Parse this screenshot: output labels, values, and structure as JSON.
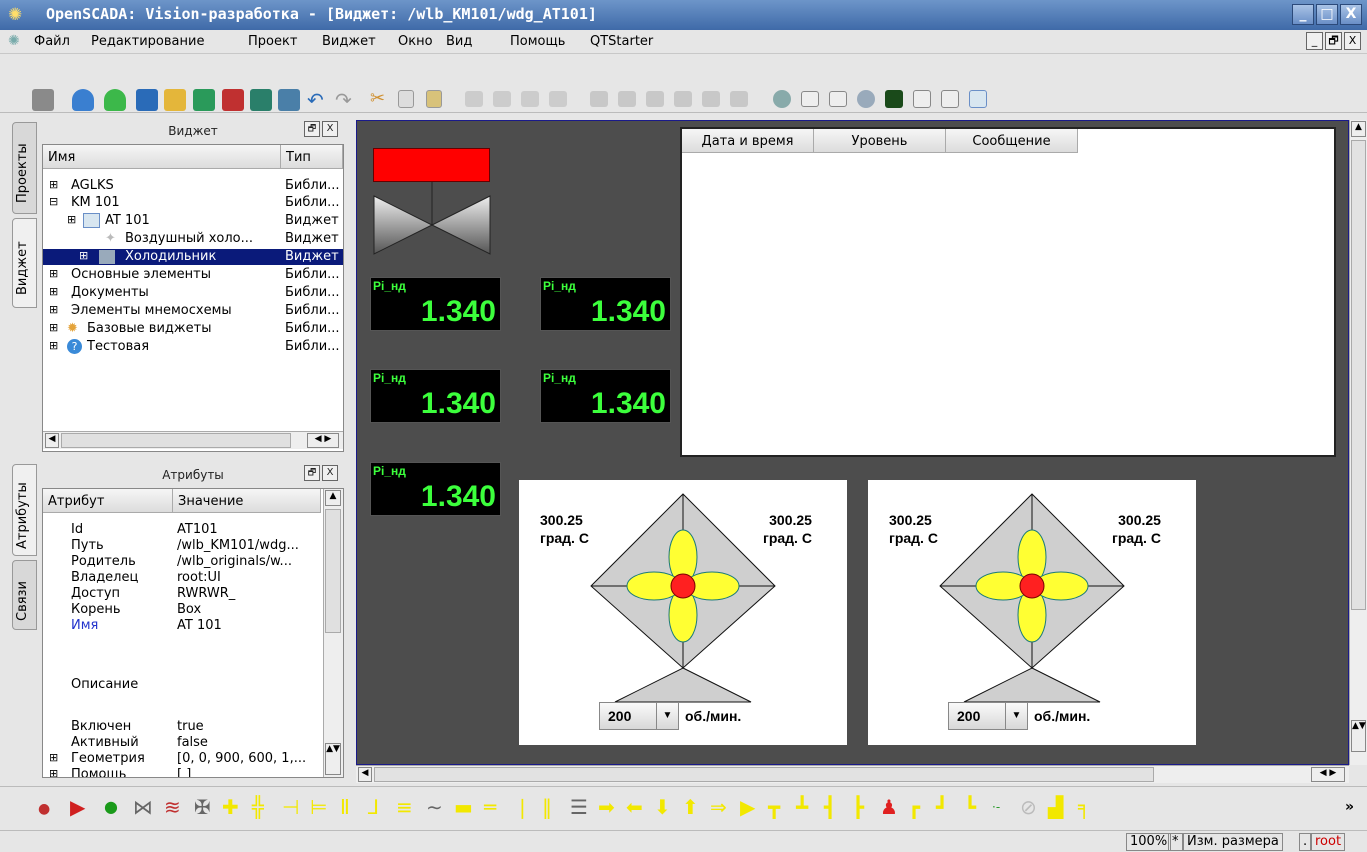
{
  "window": {
    "title": "OpenSCADA: Vision-разработка - [Виджет: /wlb_KM101/wdg_AT101]",
    "minimize": "_",
    "maximize": "□",
    "close": "X"
  },
  "menu": [
    "Файл",
    "Редактирование",
    "Проект",
    "Виджет",
    "Окно",
    "Вид",
    "Помощь",
    "QTStarter"
  ],
  "mdi_buttons": [
    "_",
    "🗗",
    "X"
  ],
  "side_tabs": {
    "projects": "Проекты",
    "widget": "Виджет",
    "attributes": "Атрибуты",
    "links": "Связи"
  },
  "widget_dock": {
    "title": "Виджет",
    "columns": [
      "Имя",
      "Тип"
    ],
    "rows": [
      {
        "name": "AGLKS",
        "type": "Библи..."
      },
      {
        "name": "KM 101",
        "type": "Библи..."
      },
      {
        "name": "AT 101",
        "type": "Виджет"
      },
      {
        "name": "Воздушный холо...",
        "type": "Виджет"
      },
      {
        "name": "Холодильник",
        "type": "Виджет"
      },
      {
        "name": "Основные элементы",
        "type": "Библи..."
      },
      {
        "name": "Документы",
        "type": "Библи..."
      },
      {
        "name": "Элементы мнемосхемы",
        "type": "Библи..."
      },
      {
        "name": "Базовые виджеты",
        "type": "Библи..."
      },
      {
        "name": "Тестовая",
        "type": "Библи..."
      }
    ]
  },
  "attr_dock": {
    "title": "Атрибуты",
    "columns": [
      "Атрибут",
      "Значение"
    ],
    "rows": [
      {
        "name": "Id",
        "value": "AT101"
      },
      {
        "name": "Путь",
        "value": "/wlb_KM101/wdg..."
      },
      {
        "name": "Родитель",
        "value": "/wlb_originals/w..."
      },
      {
        "name": "Владелец",
        "value": "root:UI"
      },
      {
        "name": "Доступ",
        "value": "RWRWR_"
      },
      {
        "name": "Корень",
        "value": "Box"
      },
      {
        "name": "Имя",
        "value": "AT 101"
      },
      {
        "name": "Описание",
        "value": ""
      },
      {
        "name": "Включен",
        "value": "true"
      },
      {
        "name": "Активный",
        "value": "false"
      },
      {
        "name": "Геометрия",
        "value": "[0, 0, 900, 600, 1,..."
      },
      {
        "name": "Помощь",
        "value": "[ ]"
      }
    ]
  },
  "indicators": [
    {
      "label": "Pi_нд",
      "value": "1.340"
    },
    {
      "label": "Pi_нд",
      "value": "1.340"
    },
    {
      "label": "Pi_нд",
      "value": "1.340"
    },
    {
      "label": "Pi_нд",
      "value": "1.340"
    },
    {
      "label": "Pi_нд",
      "value": "1.340"
    }
  ],
  "alarm_table": {
    "columns": [
      "Дата и время",
      "Уровень",
      "Сообщение"
    ]
  },
  "fans": [
    {
      "temp_left": "300.25",
      "temp_right": "300.25",
      "unit_temp": "град. С",
      "speed": "200",
      "unit_speed": "об./мин."
    },
    {
      "temp_left": "300.25",
      "temp_right": "300.25",
      "unit_temp": "град. С",
      "speed": "200",
      "unit_speed": "об./мин."
    }
  ],
  "status": {
    "zoom": "100%",
    "modified": "*",
    "mode": "Изм. размера",
    "sep": ".",
    "user": "root"
  },
  "colors": {
    "title_bg": "#4f7bb9",
    "canvas_bg": "#4d4d4d",
    "indicator_text": "#3cff3c",
    "valve_top": "#ff0000",
    "fan_blade": "#ffff33",
    "fan_hub": "#ff2020",
    "selected_row": "#0a1a7a",
    "user": "#cc0000"
  }
}
